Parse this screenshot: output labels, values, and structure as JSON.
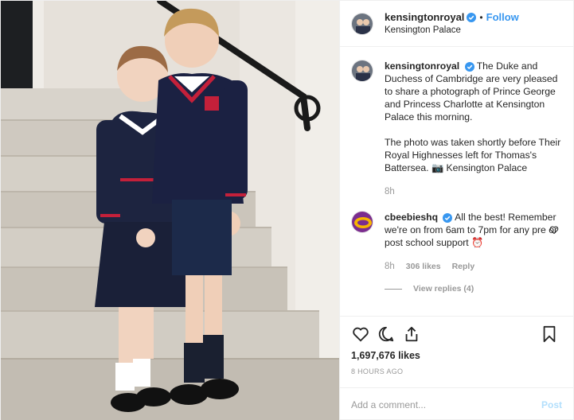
{
  "header": {
    "username": "kensingtonroyal",
    "follow_label": "Follow",
    "location": "Kensington Palace",
    "separator": "•"
  },
  "caption": {
    "username": "kensingtonroyal",
    "text": "The Duke and Duchess of Cambridge are very pleased to share a photograph of Prince George and Princess Charlotte at Kensington Palace this morning.\n\nThe photo was taken shortly before Their Royal Highnesses left for Thomas's Battersea. 📷 Kensington Palace",
    "time": "8h"
  },
  "comments": [
    {
      "username": "cbeebieshq",
      "text": "All the best! Remember we're on from 6am to 7pm for any pre or post school support ⏰",
      "time": "8h",
      "likes": "306 likes",
      "reply_label": "Reply",
      "view_replies": "View replies (4)"
    }
  ],
  "actions": {
    "like_icon": "heart-icon",
    "comment_icon": "comment-icon",
    "share_icon": "share-icon",
    "save_icon": "bookmark-icon",
    "likes_count": "1,697,676 likes",
    "time_ago": "8 HOURS AGO"
  },
  "add_comment": {
    "placeholder": "Add a comment...",
    "post_label": "Post"
  },
  "colors": {
    "accent": "#3897f0",
    "verified": "#3897f0",
    "muted": "#999999",
    "text": "#262626",
    "post_disabled": "#b2dffc"
  }
}
